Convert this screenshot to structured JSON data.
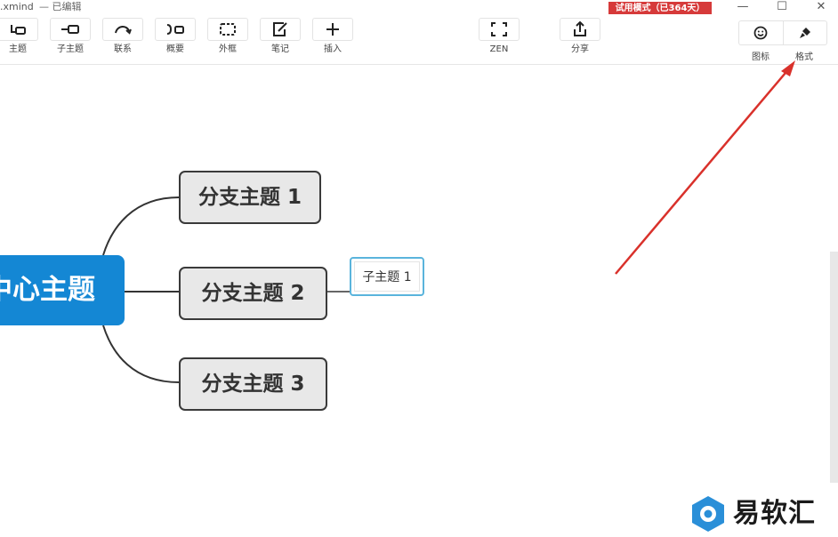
{
  "window": {
    "filename": ".xmind",
    "status": "— 已编辑",
    "trial_badge": "试用模式（已364天）",
    "min_symbol": "—",
    "max_symbol": "☐",
    "close_symbol": "✕"
  },
  "toolbar": {
    "items": [
      {
        "label": "主题",
        "icon": "topic-icon"
      },
      {
        "label": "子主题",
        "icon": "subtopic-icon"
      },
      {
        "label": "联系",
        "icon": "relationship-icon"
      },
      {
        "label": "概要",
        "icon": "summary-icon"
      },
      {
        "label": "外框",
        "icon": "boundary-icon"
      },
      {
        "label": "笔记",
        "icon": "note-icon"
      },
      {
        "label": "插入",
        "icon": "plus-icon"
      },
      {
        "label": "ZEN",
        "icon": "zen-icon"
      },
      {
        "label": "分享",
        "icon": "share-icon"
      }
    ],
    "right": [
      {
        "label": "图标",
        "icon": "smiley-icon"
      },
      {
        "label": "格式",
        "icon": "brush-icon"
      }
    ]
  },
  "mindmap": {
    "central": "中心主题",
    "branches": [
      "分支主题 1",
      "分支主题 2",
      "分支主题 3"
    ],
    "subtopic": "子主题 1"
  },
  "watermark": {
    "text": "易软汇"
  },
  "colors": {
    "central_fill": "#1487d4",
    "branch_fill": "#e8e8e8",
    "trial_badge": "#d63a3a",
    "subtopic_border": "#5ab4dc",
    "arrow": "#d9312b"
  }
}
